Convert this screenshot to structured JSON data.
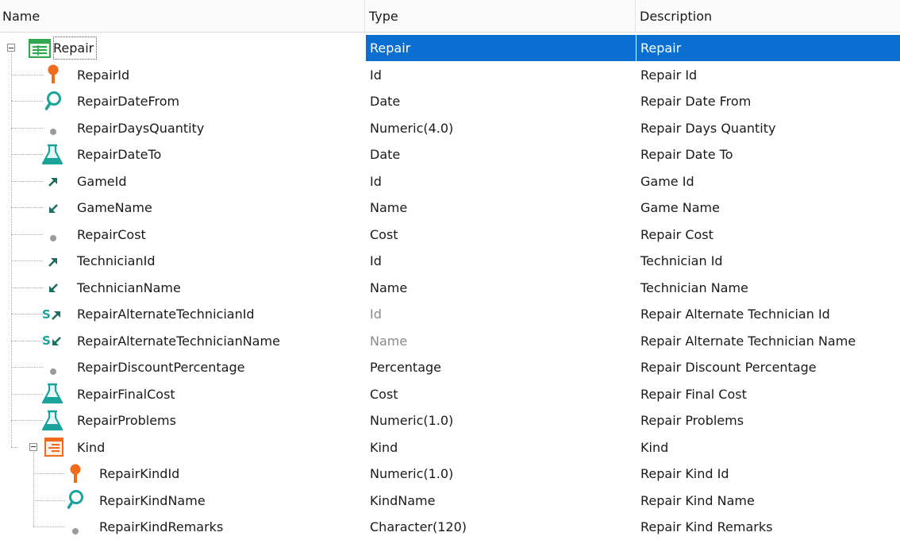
{
  "columns": {
    "name": "Name",
    "type": "Type",
    "description": "Description"
  },
  "rows": [
    {
      "name": "Repair",
      "type": "Repair",
      "description": "Repair",
      "icon": "transaction-icon",
      "level": 0,
      "selected": true,
      "expandable": true
    },
    {
      "name": "RepairId",
      "type": "Id",
      "description": "Repair Id",
      "icon": "key-icon",
      "level": 1
    },
    {
      "name": "RepairDateFrom",
      "type": "Date",
      "description": "Repair Date From",
      "icon": "candidate-key-icon",
      "level": 1
    },
    {
      "name": "RepairDaysQuantity",
      "type": "Numeric(4.0)",
      "description": "Repair Days Quantity",
      "icon": "attribute-dot-icon",
      "level": 1
    },
    {
      "name": "RepairDateTo",
      "type": "Date",
      "description": "Repair Date To",
      "icon": "formula-flask-icon",
      "level": 1
    },
    {
      "name": "GameId",
      "type": "Id",
      "description": "Game Id",
      "icon": "foreign-key-arrow-icon",
      "level": 1
    },
    {
      "name": "GameName",
      "type": "Name",
      "description": "Game Name",
      "icon": "inferred-arrow-icon",
      "level": 1
    },
    {
      "name": "RepairCost",
      "type": "Cost",
      "description": "Repair Cost",
      "icon": "attribute-dot-icon",
      "level": 1
    },
    {
      "name": "TechnicianId",
      "type": "Id",
      "description": "Technician Id",
      "icon": "foreign-key-arrow-icon",
      "level": 1
    },
    {
      "name": "TechnicianName",
      "type": "Name",
      "description": "Technician Name",
      "icon": "inferred-arrow-icon",
      "level": 1
    },
    {
      "name": "RepairAlternateTechnicianId",
      "type": "Id",
      "description": "Repair Alternate Technician Id",
      "icon": "subtype-foreign-key-icon",
      "level": 1,
      "muted": true
    },
    {
      "name": "RepairAlternateTechnicianName",
      "type": "Name",
      "description": "Repair Alternate Technician Name",
      "icon": "subtype-inferred-icon",
      "level": 1,
      "muted": true
    },
    {
      "name": "RepairDiscountPercentage",
      "type": "Percentage",
      "description": "Repair Discount Percentage",
      "icon": "attribute-dot-icon",
      "level": 1
    },
    {
      "name": "RepairFinalCost",
      "type": "Cost",
      "description": "Repair Final Cost",
      "icon": "formula-flask-icon",
      "level": 1
    },
    {
      "name": "RepairProblems",
      "type": "Numeric(1.0)",
      "description": "Repair Problems",
      "icon": "formula-flask-icon",
      "level": 1
    },
    {
      "name": "Kind",
      "type": "Kind",
      "description": "Kind",
      "icon": "level-icon",
      "level": 1,
      "expandable": true
    },
    {
      "name": "RepairKindId",
      "type": "Numeric(1.0)",
      "description": "Repair Kind Id",
      "icon": "key-icon",
      "level": 2
    },
    {
      "name": "RepairKindName",
      "type": "KindName",
      "description": "Repair Kind Name",
      "icon": "candidate-key-icon",
      "level": 2
    },
    {
      "name": "RepairKindRemarks",
      "type": "Character(120)",
      "description": "Repair Kind Remarks",
      "icon": "attribute-dot-icon",
      "level": 2
    }
  ],
  "colors": {
    "selection": "#0a6fd1",
    "key": "#f26b1d",
    "teal": "#1aa39a",
    "transaction": "#2fa84f",
    "level": "#f26b1d",
    "dot": "#9a9a9a",
    "arrow": "#1f6e62"
  }
}
